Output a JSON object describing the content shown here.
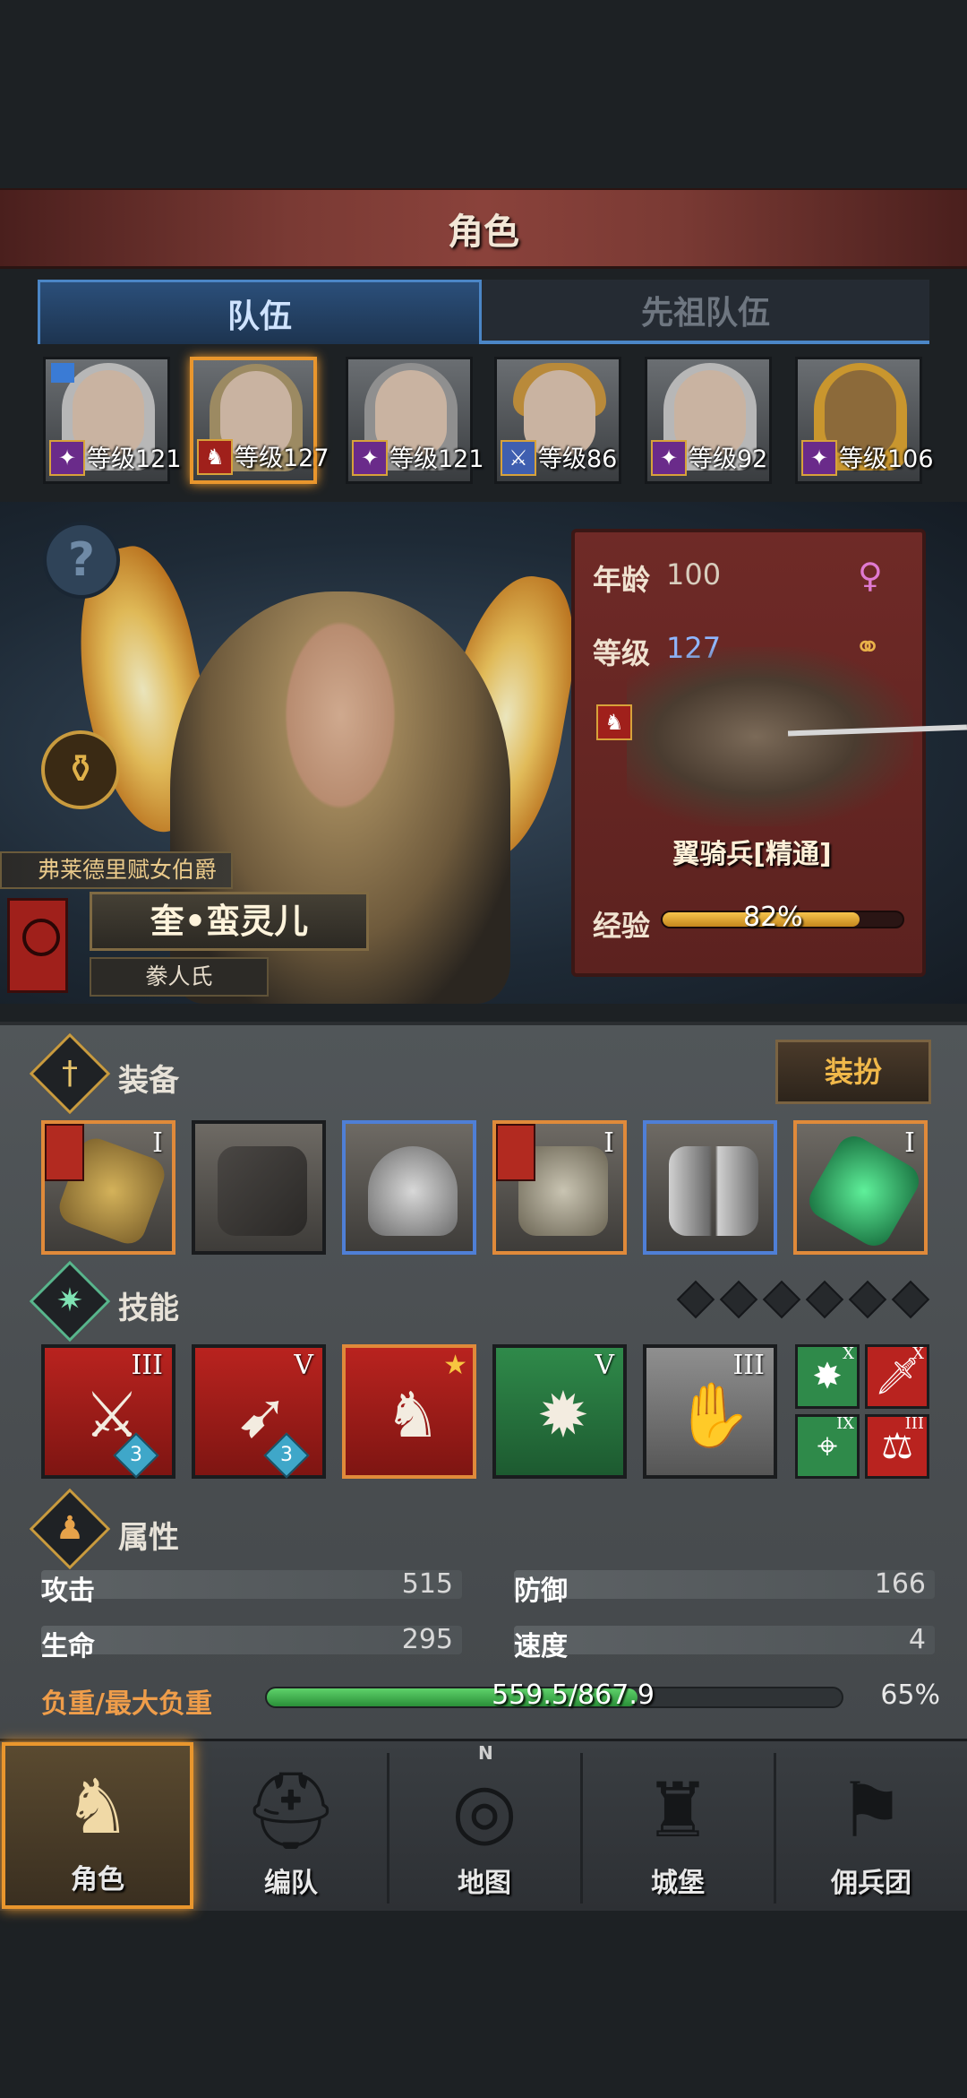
{
  "title": "角色",
  "tabs": {
    "team": "队伍",
    "ancestor": "先祖队伍"
  },
  "party": [
    {
      "level": "等级121",
      "class_icon": "staff-icon"
    },
    {
      "level": "等级127",
      "class_icon": "griffin-icon"
    },
    {
      "level": "等级121",
      "class_icon": "staff-icon"
    },
    {
      "level": "等级86",
      "class_icon": "sword-icon"
    },
    {
      "level": "等级92",
      "class_icon": "staff-icon"
    },
    {
      "level": "等级106",
      "class_icon": "staff-icon"
    }
  ],
  "hero": {
    "subtitle": "弗莱德里赋女伯爵",
    "name": "奎•蛮灵儿",
    "race": "豢人氏"
  },
  "info": {
    "age_label": "年龄",
    "age": "100",
    "level_label": "等级",
    "level": "127",
    "unit": "翼骑兵[精通]",
    "exp_label": "经验",
    "exp_text": "82%",
    "exp_fraction": 0.82
  },
  "equipment": {
    "title": "装备",
    "outfit_button": "装扮",
    "slots": [
      {
        "tier": "I",
        "icon": "shoulder-armor-icon"
      },
      {
        "tier": "",
        "icon": "cape-icon"
      },
      {
        "tier": "",
        "icon": "helmet-icon"
      },
      {
        "tier": "I",
        "icon": "chest-armor-icon"
      },
      {
        "tier": "",
        "icon": "greaves-icon"
      },
      {
        "tier": "I",
        "icon": "emerald-amulet-icon"
      }
    ]
  },
  "skills": {
    "title": "技能",
    "items": [
      {
        "tier": "III",
        "badge": "3"
      },
      {
        "tier": "V",
        "badge": "3"
      },
      {
        "tier": "",
        "badge": ""
      },
      {
        "tier": "V",
        "badge": ""
      },
      {
        "tier": "III",
        "badge": ""
      }
    ],
    "mini": [
      {
        "tier": "X"
      },
      {
        "tier": "X"
      },
      {
        "tier": "IX"
      },
      {
        "tier": "III"
      }
    ]
  },
  "attributes": {
    "title": "属性",
    "attack_label": "攻击",
    "attack": "515",
    "defense_label": "防御",
    "defense": "166",
    "hp_label": "生命",
    "hp": "295",
    "speed_label": "速度",
    "speed": "4",
    "load_label": "负重/最大负重",
    "load_text": "559.5/867.9",
    "load_pct": "65%",
    "load_fraction": 0.645
  },
  "nav": {
    "compass_n": "N",
    "items": [
      {
        "label": "角色",
        "icon": "knight-icon"
      },
      {
        "label": "编队",
        "icon": "helmet-icon"
      },
      {
        "label": "地图",
        "icon": "compass-icon"
      },
      {
        "label": "城堡",
        "icon": "castle-icon"
      },
      {
        "label": "佣兵团",
        "icon": "banner-icon"
      }
    ]
  },
  "colors": {
    "accent": "#e9962d",
    "tab_blue": "#4b86c6",
    "info_card": "#6f2a27",
    "load_green": "#3cb44c"
  }
}
